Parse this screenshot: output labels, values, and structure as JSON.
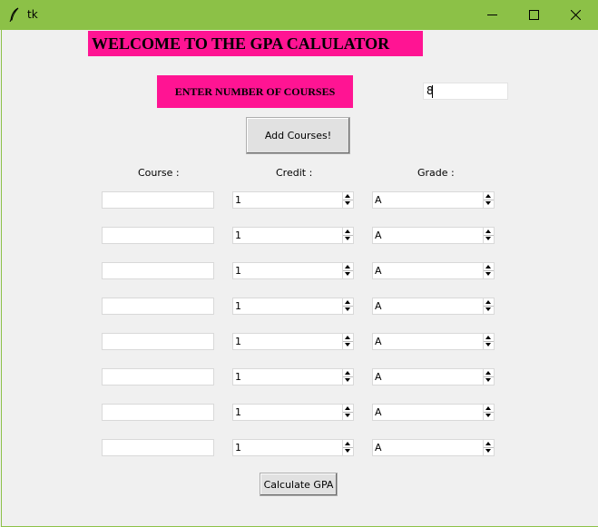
{
  "window": {
    "title": "tk",
    "icon": "feather-icon",
    "controls": [
      "minimize-icon",
      "maximize-icon",
      "close-icon"
    ]
  },
  "header": {
    "welcome": "WELCOME TO THE GPA CALULATOR",
    "enter_label": "ENTER NUMBER OF COURSES",
    "num_courses_value": "8",
    "add_button": "Add Courses!"
  },
  "columns": {
    "course": "Course :",
    "credit": "Credit :",
    "grade": "Grade :"
  },
  "rows": [
    {
      "course": "",
      "credit": "1",
      "grade": "A"
    },
    {
      "course": "",
      "credit": "1",
      "grade": "A"
    },
    {
      "course": "",
      "credit": "1",
      "grade": "A"
    },
    {
      "course": "",
      "credit": "1",
      "grade": "A"
    },
    {
      "course": "",
      "credit": "1",
      "grade": "A"
    },
    {
      "course": "",
      "credit": "1",
      "grade": "A"
    },
    {
      "course": "",
      "credit": "1",
      "grade": "A"
    },
    {
      "course": "",
      "credit": "1",
      "grade": "A"
    }
  ],
  "calculate_button": "Calculate GPA",
  "colors": {
    "titlebar": "#8cc147",
    "highlight": "#ff1493",
    "background": "#f0f0f0"
  }
}
